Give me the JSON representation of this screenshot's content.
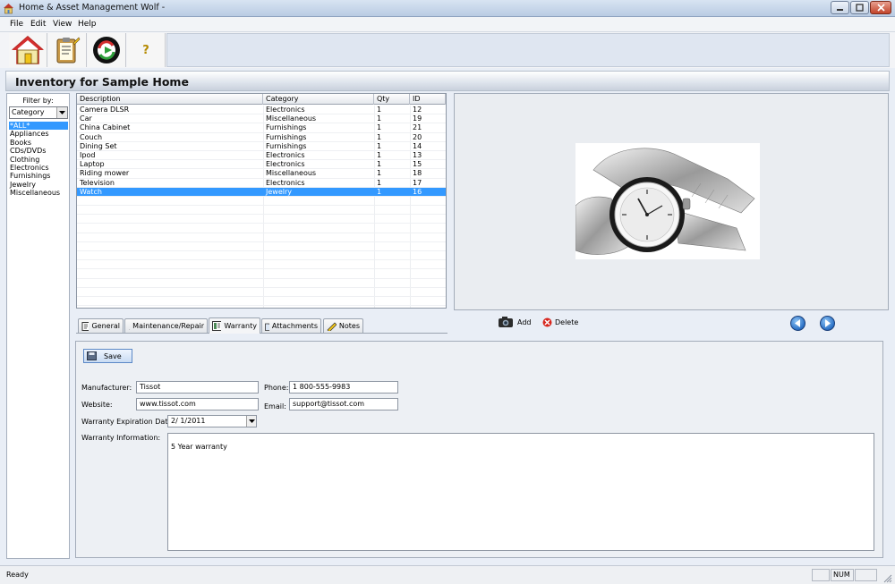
{
  "window": {
    "title": "Home & Asset Management Wolf -"
  },
  "menu": [
    "File",
    "Edit",
    "View",
    "Help"
  ],
  "toolbar": {
    "buttons": [
      {
        "name": "home",
        "icon": "house-icon"
      },
      {
        "name": "inventory",
        "icon": "clipboard-icon"
      },
      {
        "name": "refresh",
        "icon": "refresh-arrow-icon"
      },
      {
        "name": "help",
        "icon": "question-icon",
        "glyph": "?"
      }
    ]
  },
  "header": {
    "title": "Inventory for Sample Home"
  },
  "filter": {
    "label": "Filter by:",
    "selected": "Category",
    "items": [
      "*ALL*",
      "Appliances",
      "Books",
      "CDs/DVDs",
      "Clothing",
      "Electronics",
      "Furnishings",
      "Jewelry",
      "Miscellaneous"
    ],
    "selected_index": 0
  },
  "table": {
    "columns": [
      "Description",
      "Category",
      "Qty",
      "ID"
    ],
    "rows": [
      [
        "Camera DLSR",
        "Electronics",
        "1",
        "12"
      ],
      [
        "Car",
        "Miscellaneous",
        "1",
        "19"
      ],
      [
        "China Cabinet",
        "Furnishings",
        "1",
        "21"
      ],
      [
        "Couch",
        "Furnishings",
        "1",
        "20"
      ],
      [
        "Dining Set",
        "Furnishings",
        "1",
        "14"
      ],
      [
        "Ipod",
        "Electronics",
        "1",
        "13"
      ],
      [
        "Laptop",
        "Electronics",
        "1",
        "15"
      ],
      [
        "Riding mower",
        "Miscellaneous",
        "1",
        "18"
      ],
      [
        "Television",
        "Electronics",
        "1",
        "17"
      ],
      [
        "Watch",
        "Jewelry",
        "1",
        "16"
      ]
    ],
    "selected_index": 9
  },
  "image_controls": {
    "add": "Add",
    "delete": "Delete"
  },
  "tabs": [
    {
      "label": "General",
      "icon": "document-icon"
    },
    {
      "label": "Maintenance/Repair",
      "icon": "wrench-icon"
    },
    {
      "label": "Warranty",
      "icon": "certificate-icon",
      "active": true
    },
    {
      "label": "Attachments",
      "icon": "folder-icon"
    },
    {
      "label": "Notes",
      "icon": "pencil-icon"
    }
  ],
  "form": {
    "save": "Save",
    "manufacturer_label": "Manufacturer:",
    "manufacturer": "Tissot",
    "phone_label": "Phone:",
    "phone": "1 800-555-9983",
    "website_label": "Website:",
    "website": "www.tissot.com",
    "email_label": "Email:",
    "email": "support@tissot.com",
    "expiration_label": "Warranty Expiration Date:",
    "expiration": "2/  1/2011",
    "info_label": "Warranty Information:",
    "info": "5 Year warranty"
  },
  "status": {
    "text": "Ready",
    "num": "NUM"
  },
  "colors": {
    "selection": "#3399ff",
    "accent": "#2a6fc4"
  }
}
